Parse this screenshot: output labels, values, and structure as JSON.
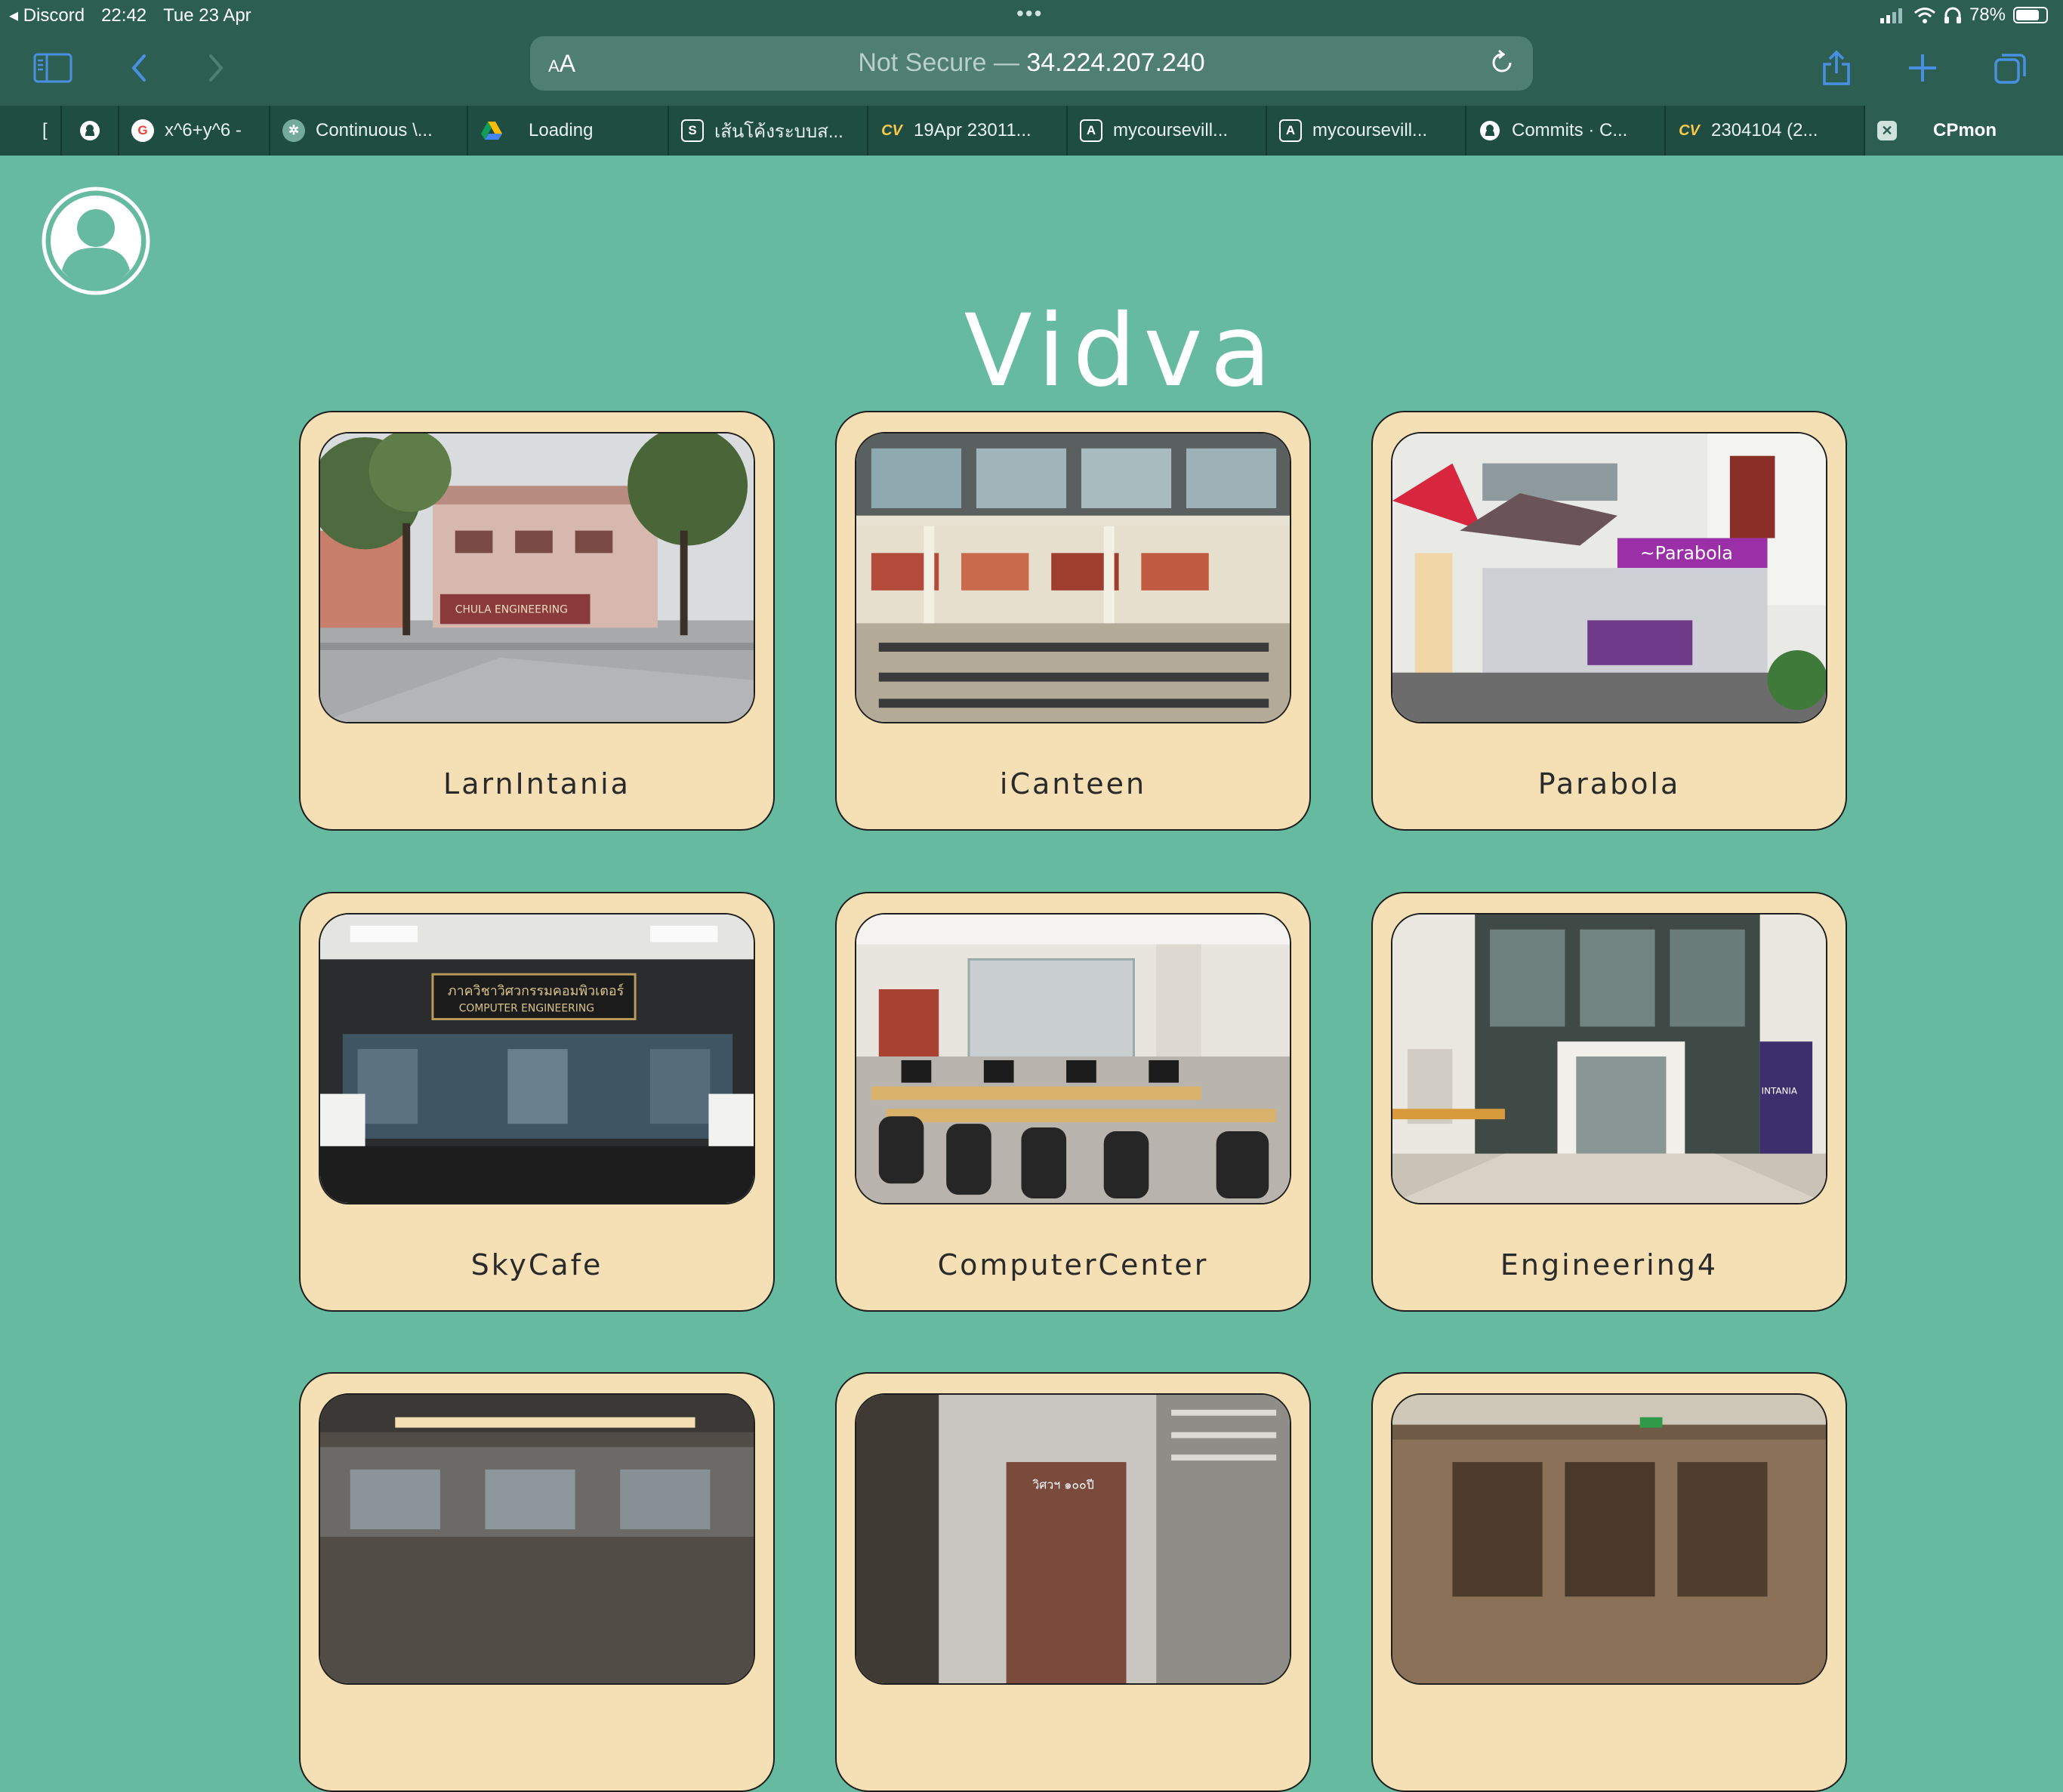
{
  "status_bar": {
    "back_app": "Discord",
    "time": "22:42",
    "date": "Tue 23 Apr",
    "battery": "78%",
    "battery_level": 0.78
  },
  "browser": {
    "text_size_button": "AA",
    "address": {
      "security": "Not Secure —",
      "host": "34.224.207.240"
    },
    "tabs": [
      {
        "label": "x^6+y^6 -",
        "icon": "google-icon"
      },
      {
        "label": "Continuous \\...",
        "icon": "chatgpt-icon"
      },
      {
        "label": "Loading",
        "icon": "google-drive-icon"
      },
      {
        "label": "เส้นโค้งระบบส...",
        "icon": "scribd-icon"
      },
      {
        "label": "19Apr 23011...",
        "icon": "mycourseville-icon"
      },
      {
        "label": "mycoursevill...",
        "icon": "a-icon"
      },
      {
        "label": "mycoursevill...",
        "icon": "a-icon"
      },
      {
        "label": "Commits · C...",
        "icon": "github-icon"
      },
      {
        "label": "2304104 (2...",
        "icon": "mycourseville-icon"
      },
      {
        "label": "CPmon",
        "icon": "close-tab-icon"
      }
    ]
  },
  "site": {
    "title": "Vidva",
    "cards": [
      {
        "label": "LarnIntania",
        "photo": "courtyard-building"
      },
      {
        "label": "iCanteen",
        "photo": "canteen-hall"
      },
      {
        "label": "Parabola",
        "photo": "food-stall"
      },
      {
        "label": "SkyCafe",
        "photo": "cafe-glass-front"
      },
      {
        "label": "ComputerCenter",
        "photo": "computer-lab"
      },
      {
        "label": "Engineering4",
        "photo": "glass-entrance"
      },
      {
        "label": "",
        "photo": "lounge-interior"
      },
      {
        "label": "",
        "photo": "street-buildings"
      },
      {
        "label": "",
        "photo": "wood-room"
      }
    ],
    "photo_signs": {
      "chula": "CHULA ENGINEERING",
      "parabola": "~Parabola",
      "thai_computer": "ภาควิชาวิศวกรรมคอมพิวเตอร์",
      "computer_engineering": "COMPUTER ENGINEERING",
      "intania": "INTANIA",
      "thai_building": "วิศวฯ ๑๐๐ปี"
    }
  },
  "colors": {
    "page_bg": "#66BA9F",
    "chrome": "#2C5F52",
    "tab_strip": "#1F4D41",
    "card_bg": "#F5DFB4",
    "accent": "#3B82F6"
  }
}
